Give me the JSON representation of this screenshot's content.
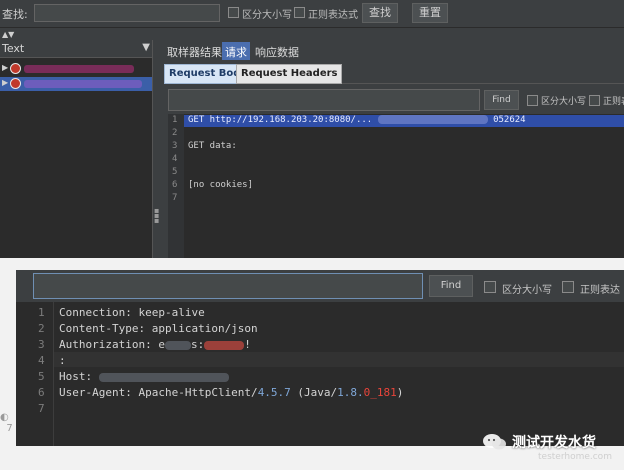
{
  "top_panel": {
    "filter_label": "查找:",
    "case_label": "区分大小写",
    "regex_label": "正则表达式",
    "search_button": "查找",
    "reset_button": "重置",
    "tree_header": "Text",
    "result_tabs": [
      "取样器结果",
      "请求",
      "响应数据"
    ],
    "request_tabs": [
      "Request Body",
      "Request Headers"
    ],
    "find_button": "Find",
    "case_checkbox": "区分大小写",
    "regex_checkbox": "正则表",
    "editor_lines": [
      {
        "n": "1",
        "text": "GET http://192.168.203.20:8080/..."
      },
      {
        "n": "2",
        "text": ""
      },
      {
        "n": "3",
        "text": "GET data:"
      },
      {
        "n": "4",
        "text": ""
      },
      {
        "n": "5",
        "text": ""
      },
      {
        "n": "6",
        "text": "[no cookies]"
      },
      {
        "n": "7",
        "text": ""
      }
    ],
    "line1_suffix": "052624"
  },
  "bottom_panel": {
    "find_button": "Find",
    "case_checkbox": "区分大小写",
    "regex_checkbox": "正则表达",
    "lines": [
      {
        "n": "1",
        "text": "Connection: keep-alive"
      },
      {
        "n": "2",
        "text": "Content-Type: application/json"
      },
      {
        "n": "3",
        "text_prefix": "Authorization: e",
        "text_mid": "s:",
        "text_red": "...",
        "text_suffix": "!"
      },
      {
        "n": "4",
        "text": ":"
      },
      {
        "n": "5",
        "text": "Host: "
      },
      {
        "n": "6",
        "text_prefix": "User-Agent: Apache-HttpClient/",
        "v1": "4.5.7",
        "mid": " (Java/",
        "v2a": "1.8.",
        "v2b": "0_181",
        "end": ")"
      },
      {
        "n": "7",
        "text": ""
      }
    ]
  },
  "watermark": {
    "text": "测试开发水货",
    "sub": "testerhome.com"
  }
}
